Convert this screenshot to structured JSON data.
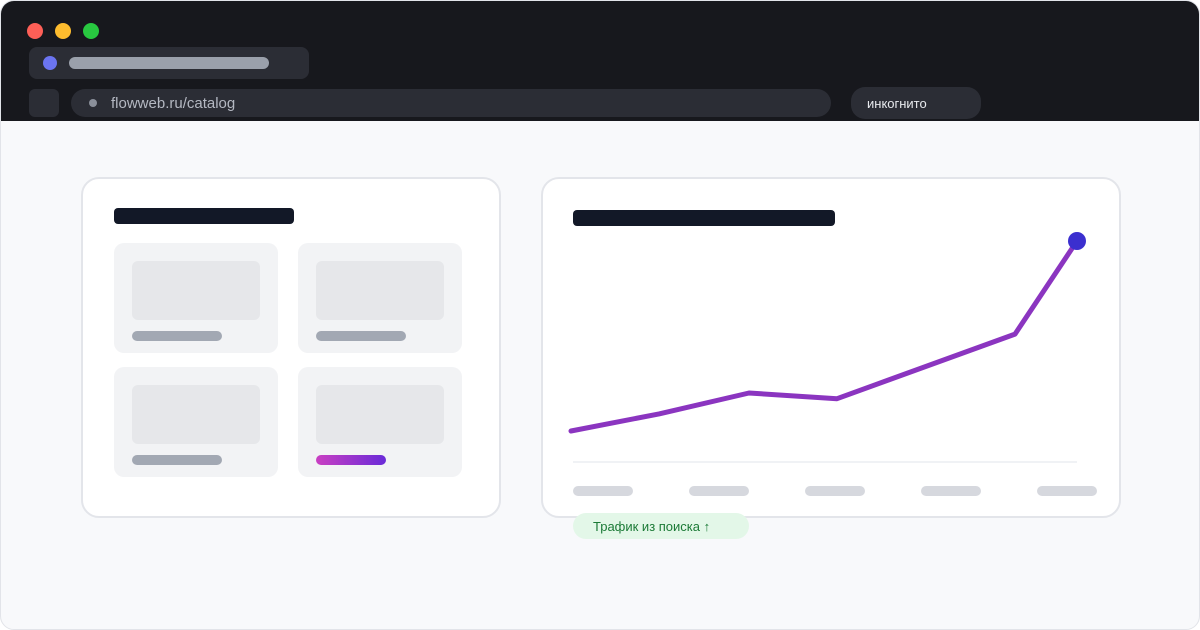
{
  "browser": {
    "address_url": "flowweb.ru/catalog",
    "mode_label": "инкогнито"
  },
  "chart_data": {
    "type": "line",
    "series": [
      {
        "values": [
          0.0,
          0.09,
          0.2,
          0.17,
          0.51,
          1.0
        ]
      }
    ],
    "x_tick_count": 5,
    "color": "#8b35c0",
    "endpoint_color": "#3b2fcf",
    "grid": false
  },
  "badge": {
    "label": "Трафик из поиска ↑"
  },
  "colors": {
    "accent_start": "#c93fc2",
    "accent_end": "#6a2bd8",
    "badge_text": "#1b7a36",
    "badge_bg": "#e3f7e8"
  }
}
